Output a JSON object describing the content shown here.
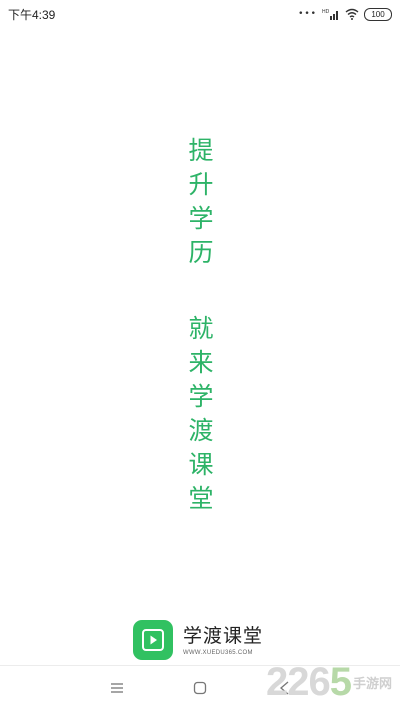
{
  "status_bar": {
    "time": "下午4:39",
    "hd_label": "HD",
    "battery_level": "100",
    "icons": [
      "more-dots-icon",
      "signal-icon",
      "wifi-icon",
      "battery-icon"
    ]
  },
  "slogan": {
    "line1": [
      "提",
      "升",
      "学",
      "历"
    ],
    "line2": [
      "就",
      "来",
      "学",
      "渡",
      "课",
      "堂"
    ],
    "color": "#2db367"
  },
  "brand": {
    "name": "学渡课堂",
    "url": "WWW.XUEDU365.COM",
    "logo_color": "#31c161",
    "logo_icon": "play-icon"
  },
  "nav_bar": {
    "icons": [
      "menu-icon",
      "home-icon",
      "back-icon"
    ]
  },
  "watermark": {
    "number_main": "226",
    "number_accent": "5",
    "site": "手游网"
  }
}
